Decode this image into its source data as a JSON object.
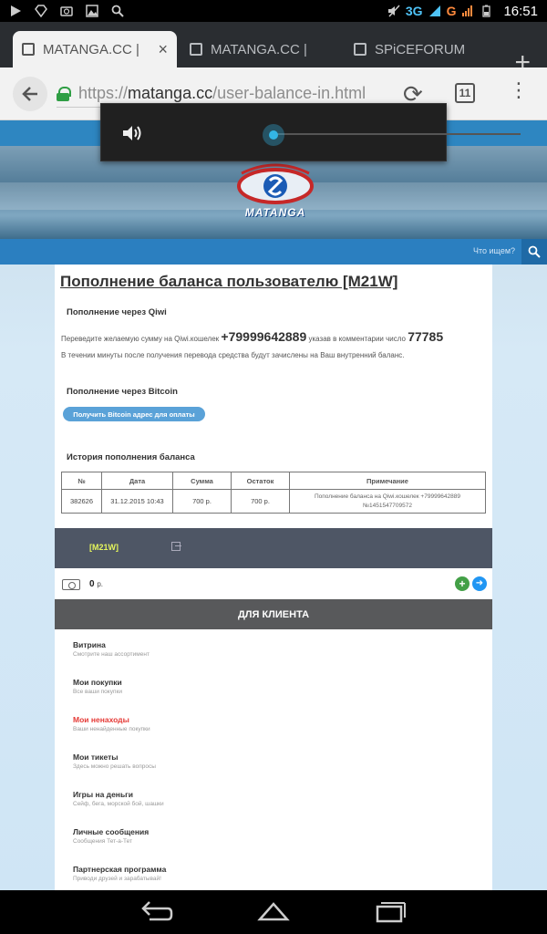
{
  "status_bar": {
    "network": "3G",
    "network2": "G",
    "time": "16:51"
  },
  "tabs": [
    {
      "title": "MATANGA.CC |"
    },
    {
      "title": "MATANGA.CC |"
    },
    {
      "title": "SPiCEFORUM"
    }
  ],
  "address_bar": {
    "url_prefix": "https://",
    "url_domain": "matanga.cc",
    "url_path": "/user-balance-in.html",
    "tab_count": "11"
  },
  "site": {
    "logo_text": "MATANGA",
    "search_placeholder": "Что ищем?"
  },
  "content": {
    "title": "Пополнение баланса пользователю [M21W]",
    "qiwi_heading": "Пополнение через Qiwi",
    "qiwi_line_a": "Переведите желаемую сумму на Qiwi.кошелек",
    "qiwi_number": "+79999642889",
    "qiwi_line_b": "указав в комментарии число",
    "qiwi_code": "77785",
    "qiwi_note": "В течении минуты после получения перевода средства будут зачислены на Ваш внутренний баланс.",
    "btc_heading": "Пополнение через Bitcoin",
    "btc_button": "Получить Bitcoin адрес для оплаты",
    "history_heading": "История пополнения баланса",
    "table": {
      "headers": [
        "№",
        "Дата",
        "Сумма",
        "Остаток",
        "Примечание"
      ],
      "rows": [
        {
          "num": "382626",
          "date": "31.12.2015 10:43",
          "sum": "700 р.",
          "rest": "700 р.",
          "note1": "Пополнение баланса на Qiwi.кошелек +79999642889",
          "note2": "№1451547709572"
        }
      ]
    }
  },
  "user": {
    "name": "[M21W]",
    "balance": "0",
    "currency": "р."
  },
  "client_menu": {
    "title": "ДЛЯ КЛИЕНТА",
    "items": [
      {
        "title": "Витрина",
        "subtitle": "Смотрите наш ассортимент"
      },
      {
        "title": "Мои покупки",
        "subtitle": "Все ваши покупки"
      },
      {
        "title": "Мои ненаходы",
        "subtitle": "Ваши ненайденные покупки"
      },
      {
        "title": "Мои тикеты",
        "subtitle": "Здесь можно решать вопросы"
      },
      {
        "title": "Игры на деньги",
        "subtitle": "Сейф, бега, морской бой, шашки"
      },
      {
        "title": "Личные сообщения",
        "subtitle": "Сообщения Тет-а-Тет"
      },
      {
        "title": "Партнерская программа",
        "subtitle": "Приводи друзей и зарабатывай!"
      }
    ]
  },
  "volume": {
    "level": 0.0
  },
  "colors": {
    "accent_blue": "#2b7fc0",
    "username_yellow": "#e5f55c",
    "alert_red": "#e53935",
    "user_bar": "#4e5665"
  }
}
